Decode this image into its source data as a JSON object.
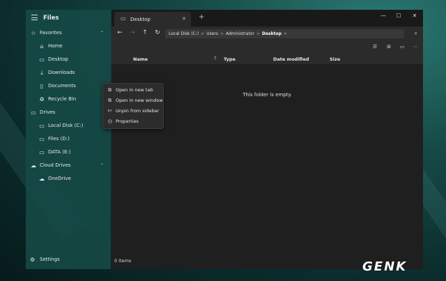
{
  "sidebar": {
    "app_title": "Files",
    "favorites_label": "Favorites",
    "favorites": [
      {
        "label": "Home",
        "icon": "home-icon"
      },
      {
        "label": "Desktop",
        "icon": "desktop-icon"
      },
      {
        "label": "Downloads",
        "icon": "download-icon"
      },
      {
        "label": "Documents",
        "icon": "document-icon"
      },
      {
        "label": "Recycle Bin",
        "icon": "recycle-bin-icon"
      }
    ],
    "drives_label": "Drives",
    "drives": [
      {
        "label": "Local Disk (C:)",
        "icon": "drive-icon"
      },
      {
        "label": "Files (D:)",
        "icon": "drive-icon"
      },
      {
        "label": "DATA (E:)",
        "icon": "drive-icon"
      }
    ],
    "cloud_label": "Cloud Drives",
    "cloud": [
      {
        "label": "OneDrive",
        "icon": "cloud-icon"
      }
    ],
    "settings_label": "Settings"
  },
  "tab": {
    "label": "Desktop"
  },
  "breadcrumb": {
    "items": [
      "Local Disk (C:)",
      "Users",
      "Administrator",
      "Desktop"
    ]
  },
  "columns": {
    "name": "Name",
    "type": "Type",
    "date_modified": "Date modified",
    "size": "Size"
  },
  "content": {
    "empty_message": "This folder is empty."
  },
  "status": {
    "item_count": "0 items"
  },
  "context_menu": {
    "items": [
      {
        "label": "Open in new tab",
        "icon": "new-tab-icon"
      },
      {
        "label": "Open in new window",
        "icon": "new-window-icon"
      },
      {
        "label": "Unpin from sidebar",
        "icon": "unpin-icon"
      },
      {
        "label": "Properties",
        "icon": "properties-icon"
      }
    ]
  },
  "watermark": {
    "text": "GENK"
  }
}
